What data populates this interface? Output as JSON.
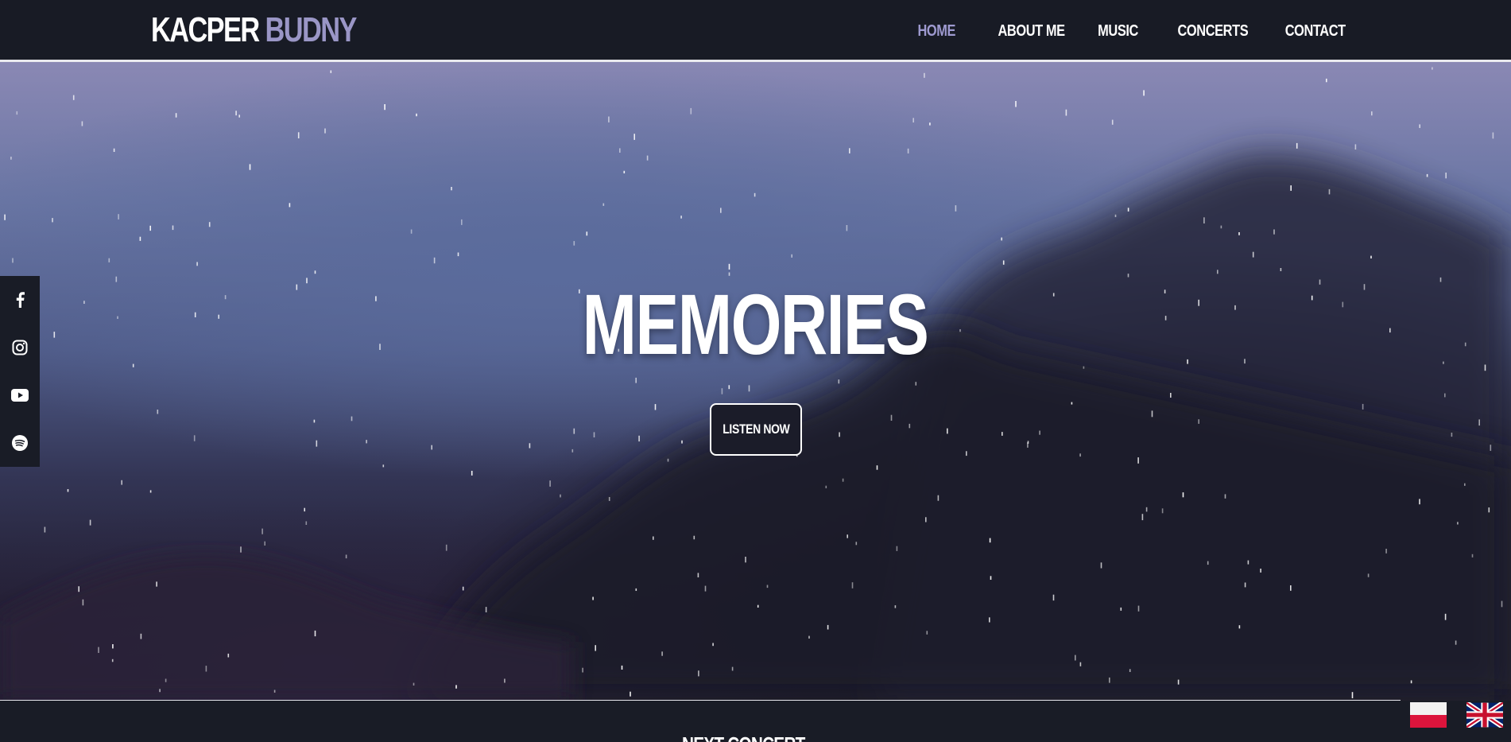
{
  "brand": {
    "first": "KACPER",
    "last": "BUDNY",
    "accent_color": "#9a96c6"
  },
  "nav": {
    "items": [
      {
        "label": "HOME",
        "active": true
      },
      {
        "label": "ABOUT ME",
        "active": false
      },
      {
        "label": "MUSIC",
        "active": false
      },
      {
        "label": "CONCERTS",
        "active": false
      },
      {
        "label": "CONTACT",
        "active": false
      }
    ]
  },
  "hero": {
    "title": "MEMORIES",
    "cta_label": "LISTEN NOW"
  },
  "social": {
    "icons": [
      "facebook-icon",
      "instagram-icon",
      "youtube-icon",
      "spotify-icon"
    ]
  },
  "next_section": {
    "heading_partial": "NEXT CONCERT"
  },
  "languages": [
    {
      "code": "pl",
      "icon": "poland-flag-icon"
    },
    {
      "code": "en",
      "icon": "uk-flag-icon"
    }
  ]
}
